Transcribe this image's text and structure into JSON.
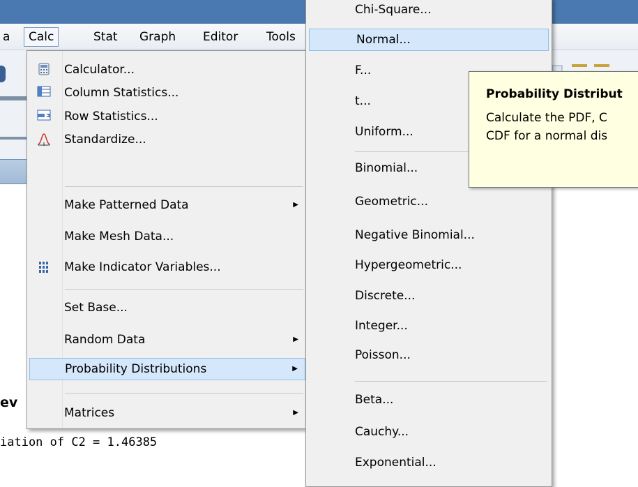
{
  "menubar": {
    "items": [
      {
        "label": "a"
      },
      {
        "label": "Calc"
      },
      {
        "label": "Stat"
      },
      {
        "label": "Graph"
      },
      {
        "label": "Editor"
      },
      {
        "label": "Tools"
      }
    ]
  },
  "calc_menu": {
    "items": [
      {
        "label": "Calculator...",
        "icon": "calculator-icon"
      },
      {
        "label": "Column Statistics...",
        "icon": "column-statistics-icon"
      },
      {
        "label": "Row Statistics...",
        "icon": "row-statistics-icon"
      },
      {
        "label": "Standardize...",
        "icon": "standardize-icon"
      },
      {
        "label": "Make Patterned Data",
        "submenu": true
      },
      {
        "label": "Make Mesh Data..."
      },
      {
        "label": "Make Indicator Variables...",
        "icon": "indicator-variables-icon"
      },
      {
        "label": "Set Base..."
      },
      {
        "label": "Random Data",
        "submenu": true
      },
      {
        "label": "Probability Distributions",
        "submenu": true,
        "highlighted": true
      },
      {
        "label": "Matrices",
        "submenu": true
      }
    ]
  },
  "distributions_menu": {
    "items": [
      {
        "label": "Chi-Square..."
      },
      {
        "label": "Normal...",
        "highlighted": true
      },
      {
        "label": "F..."
      },
      {
        "label": "t..."
      },
      {
        "label": "Uniform..."
      },
      {
        "label": "Binomial..."
      },
      {
        "label": "Geometric..."
      },
      {
        "label": "Negative Binomial..."
      },
      {
        "label": "Hypergeometric..."
      },
      {
        "label": "Discrete..."
      },
      {
        "label": "Integer..."
      },
      {
        "label": "Poisson..."
      },
      {
        "label": "Beta..."
      },
      {
        "label": "Cauchy..."
      },
      {
        "label": "Exponential..."
      }
    ]
  },
  "tooltip": {
    "title": "Probability Distribut",
    "line1": "Calculate the PDF, C",
    "line2": "CDF for a normal dis"
  },
  "session": {
    "bold_fragment": "ev",
    "output_line": "iation of C2 = 1.46385"
  }
}
